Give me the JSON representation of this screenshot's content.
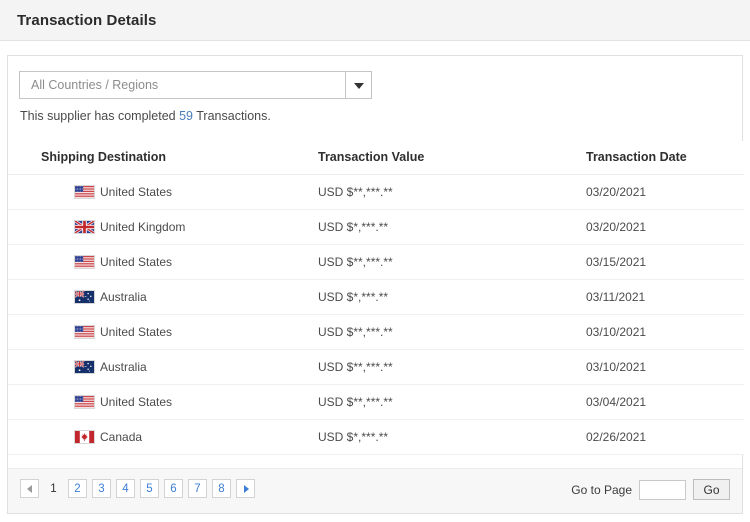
{
  "header": {
    "title": "Transaction Details"
  },
  "filter": {
    "selected_value": "All Countries / Regions",
    "dropdown_icon": "chevron-down-icon",
    "options": [
      "All Countries / Regions"
    ]
  },
  "summary": {
    "prefix": "This supplier has completed ",
    "count": "59",
    "suffix": " Transactions.",
    "count_color": "#4a7ebb"
  },
  "table": {
    "columns": [
      "Shipping Destination",
      "Transaction Value",
      "Transaction Date"
    ],
    "rows": [
      {
        "flag": "flag-us-icon",
        "destination": "United States",
        "value": "USD $**,***.**",
        "date": "03/20/2021"
      },
      {
        "flag": "flag-gb-icon",
        "destination": "United Kingdom",
        "value": "USD $*,***.**",
        "date": "03/20/2021"
      },
      {
        "flag": "flag-us-icon",
        "destination": "United States",
        "value": "USD $**,***.**",
        "date": "03/15/2021"
      },
      {
        "flag": "flag-au-icon",
        "destination": "Australia",
        "value": "USD $*,***.**",
        "date": "03/11/2021"
      },
      {
        "flag": "flag-us-icon",
        "destination": "United States",
        "value": "USD $**,***.**",
        "date": "03/10/2021"
      },
      {
        "flag": "flag-au-icon",
        "destination": "Australia",
        "value": "USD $**,***.**",
        "date": "03/10/2021"
      },
      {
        "flag": "flag-us-icon",
        "destination": "United States",
        "value": "USD $**,***.**",
        "date": "03/04/2021"
      },
      {
        "flag": "flag-ca-icon",
        "destination": "Canada",
        "value": "USD $*,***.**",
        "date": "02/26/2021"
      }
    ]
  },
  "pagination": {
    "prev_icon": "triangle-left-icon",
    "next_icon": "triangle-right-icon",
    "current_page": "1",
    "pages": [
      "2",
      "3",
      "4",
      "5",
      "6",
      "7",
      "8"
    ],
    "link_color": "#3d7fd4",
    "goto_label": "Go to Page",
    "goto_value": "",
    "goto_placeholder": "",
    "go_button": "Go"
  }
}
